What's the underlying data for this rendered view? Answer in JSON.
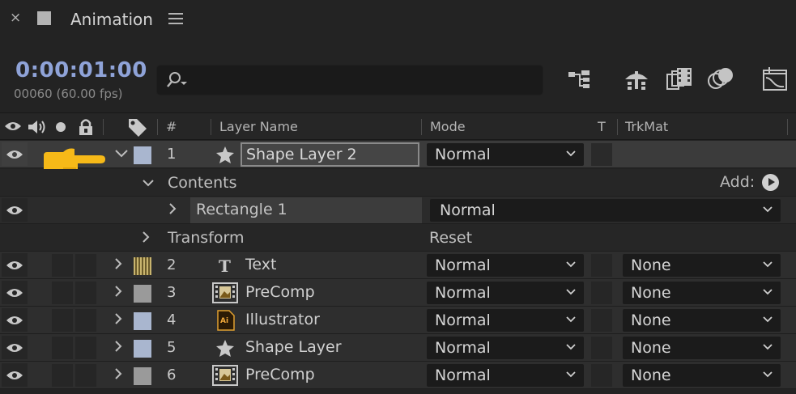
{
  "panel": {
    "close_glyph": "×",
    "title": "Animation",
    "menu_icon": "hamburger-menu-icon"
  },
  "timecode": {
    "value": "0:00:01:00",
    "frames": "00060 (60.00 fps)"
  },
  "search": {
    "placeholder": "",
    "value": ""
  },
  "toolbar": [
    "composition-flowchart-icon",
    "draft-3d-icon",
    "frame-blending-icon",
    "motion-blur-icon",
    "graph-editor-icon"
  ],
  "columns": {
    "number": "#",
    "layer_name": "Layer Name",
    "mode": "Mode",
    "t": "T",
    "trkmat": "TrkMat"
  },
  "selected_layer": {
    "number": "1",
    "name": "Shape Layer 2",
    "mode": "Normal",
    "label_color": "#a9b6cf"
  },
  "contents": {
    "label": "Contents",
    "add_label": "Add:",
    "rectangle_name": "Rectangle 1",
    "rectangle_mode": "Normal"
  },
  "transform": {
    "label": "Transform",
    "reset_label": "Reset"
  },
  "layers": [
    {
      "number": "2",
      "name": "Text",
      "icon": "text-layer-icon",
      "mode": "Normal",
      "trkmat": "None",
      "label_color": "#c8b46e"
    },
    {
      "number": "3",
      "name": "PreComp",
      "icon": "precomp-icon",
      "mode": "Normal",
      "trkmat": "None",
      "label_color": "#9a9a9a"
    },
    {
      "number": "4",
      "name": "Illustrator",
      "icon": "illustrator-file-icon",
      "mode": "Normal",
      "trkmat": "None",
      "label_color": "#a9b6cf"
    },
    {
      "number": "5",
      "name": "Shape Layer",
      "icon": "shape-star-icon",
      "mode": "Normal",
      "trkmat": "None",
      "label_color": "#a9b6cf"
    },
    {
      "number": "6",
      "name": "PreComp",
      "icon": "precomp-icon",
      "mode": "Normal",
      "trkmat": "None",
      "label_color": "#9a9a9a"
    }
  ],
  "colors": {
    "timecode": "#8fa3d8",
    "pointer_hand": "#f6b918"
  }
}
